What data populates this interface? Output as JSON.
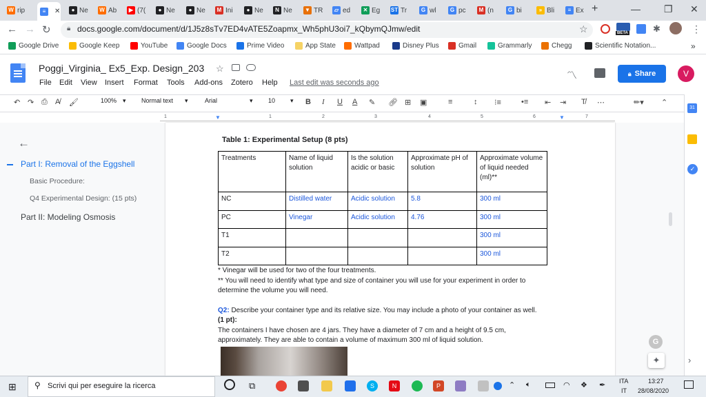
{
  "browser": {
    "tabs": [
      {
        "label": "rip",
        "icon": "W",
        "color": "#ff6d00"
      },
      {
        "label": "",
        "icon": "≡",
        "color": "#4285f4",
        "active": true
      },
      {
        "label": "Ne",
        "icon": "●",
        "color": "#202124"
      },
      {
        "label": "Ab",
        "icon": "W",
        "color": "#ff6d00"
      },
      {
        "label": "(7(",
        "icon": "▶",
        "color": "#ff0000"
      },
      {
        "label": "Ne",
        "icon": "●",
        "color": "#202124"
      },
      {
        "label": "Ne",
        "icon": "●",
        "color": "#202124"
      },
      {
        "label": "Ini",
        "icon": "M",
        "color": "#d93025"
      },
      {
        "label": "Ne",
        "icon": "●",
        "color": "#202124"
      },
      {
        "label": "Ne",
        "icon": "N",
        "color": "#202124"
      },
      {
        "label": "TR",
        "icon": "▼",
        "color": "#e8710a"
      },
      {
        "label": "ed",
        "icon": "▱",
        "color": "#4285f4"
      },
      {
        "label": "Eg",
        "icon": "✕",
        "color": "#0f9d58"
      },
      {
        "label": "Tr",
        "icon": "ST",
        "color": "#1a73e8"
      },
      {
        "label": "wl",
        "icon": "G",
        "color": "#4285f4"
      },
      {
        "label": "pc",
        "icon": "G",
        "color": "#4285f4"
      },
      {
        "label": "(n",
        "icon": "M",
        "color": "#d93025"
      },
      {
        "label": "bi",
        "icon": "G",
        "color": "#4285f4"
      },
      {
        "label": "Bli",
        "icon": "»",
        "color": "#fbbc04"
      },
      {
        "label": "Ex",
        "icon": "≡",
        "color": "#4285f4"
      }
    ],
    "new_tab": "+",
    "window_controls": {
      "minimize": "—",
      "maximize": "❐",
      "close": "✕"
    },
    "url": "docs.google.com/document/d/1J5z8sTv7ED4vATE5Zoapmx_Wh5phU3oi7_kQbymQJmw/edit",
    "beta_badge": "BETA",
    "bookmarks": [
      {
        "label": "Google Drive",
        "color": "#0f9d58"
      },
      {
        "label": "Google Keep",
        "color": "#fbbc04"
      },
      {
        "label": "YouTube",
        "color": "#ff0000"
      },
      {
        "label": "Google Docs",
        "color": "#4285f4"
      },
      {
        "label": "Prime Video",
        "color": "#1a73e8"
      },
      {
        "label": "App State",
        "color": "#f6d365"
      },
      {
        "label": "Wattpad",
        "color": "#ff6d00"
      },
      {
        "label": "Disney Plus",
        "color": "#1a3a8a"
      },
      {
        "label": "Gmail",
        "color": "#d93025"
      },
      {
        "label": "Grammarly",
        "color": "#15c39a"
      },
      {
        "label": "Chegg",
        "color": "#eb7100"
      },
      {
        "label": "Scientific Notation...",
        "color": "#202124"
      }
    ],
    "bookmarks_more": "»"
  },
  "docs": {
    "title": "Poggi_Virginia_ Ex5_Exp. Design_203",
    "menu": [
      "File",
      "Edit",
      "View",
      "Insert",
      "Format",
      "Tools",
      "Add-ons",
      "Zotero",
      "Help"
    ],
    "last_edit": "Last edit was seconds ago",
    "share": "Share",
    "avatar": "V",
    "toolbar": {
      "zoom": "100%",
      "style": "Normal text",
      "font": "Arial",
      "size": "10",
      "bold": "B",
      "italic": "I",
      "underline": "U",
      "text_color": "A"
    },
    "ruler_numbers": [
      "1",
      "1",
      "2",
      "3",
      "4",
      "5",
      "6",
      "7"
    ]
  },
  "outline": {
    "items": [
      {
        "label": "Part I: Removal of the Eggshell",
        "level": 1,
        "active": true
      },
      {
        "label": "Basic Procedure:",
        "level": 2
      },
      {
        "label": "Q4 Experimental Design: (15 pts)",
        "level": 2
      },
      {
        "label": "Part II: Modeling Osmosis",
        "level": 1
      }
    ]
  },
  "document": {
    "table_title": "Table 1: Experimental Setup (8 pts)",
    "table": {
      "headers": [
        "Treatments",
        "Name of liquid solution",
        "Is the solution acidic or basic",
        "Approximate pH of solution",
        "Approximate volume of liquid needed (ml)**"
      ],
      "rows": [
        [
          "NC",
          "Distilled water",
          "Acidic solution",
          "5.8",
          "300 ml"
        ],
        [
          "PC",
          "Vinegar",
          "Acidic solution",
          "4.76",
          "300 ml"
        ],
        [
          "T1",
          "",
          "",
          "",
          "300 ml"
        ],
        [
          "T2",
          "",
          "",
          "",
          "300 ml"
        ]
      ]
    },
    "footnote1": "* Vinegar will be used for two of the four treatments.",
    "footnote2": "** You will need to identify what type and size of container you will use for your experiment in order to determine the volume you will need.",
    "q2_label": "Q2:",
    "q2_text": "Describe your container type and its relative size. You may include a photo of your container as well.",
    "q2_points": "(1 pt):",
    "q2_answer": "The containers I have chosen are 4 jars. They have a diameter of 7 cm and a height of 9.5 cm, approximately. They are able to contain a volume of maximum 300 ml of liquid solution."
  },
  "taskbar": {
    "search_placeholder": "Scrivi qui per eseguire la ricerca",
    "language_top": "ITA",
    "language_bottom": "IT",
    "time": "13:27",
    "date": "28/08/2020"
  }
}
